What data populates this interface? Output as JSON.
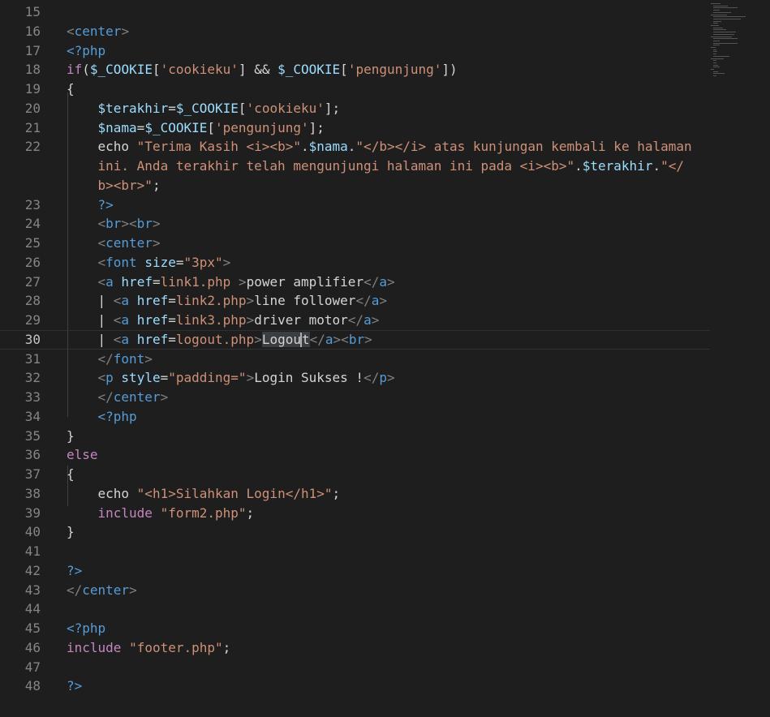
{
  "editor": {
    "active_line": 30,
    "lines": [
      {
        "n": "15",
        "indent": 0,
        "tokens": []
      },
      {
        "n": "16",
        "indent": 0,
        "tokens": [
          [
            "punc",
            "<"
          ],
          [
            "tag",
            "center"
          ],
          [
            "punc",
            ">"
          ]
        ]
      },
      {
        "n": "17",
        "indent": 0,
        "tokens": [
          [
            "tag",
            "<?php"
          ]
        ]
      },
      {
        "n": "18",
        "indent": 0,
        "tokens": [
          [
            "kw",
            "if"
          ],
          [
            "text",
            "("
          ],
          [
            "var",
            "$_COOKIE"
          ],
          [
            "text",
            "["
          ],
          [
            "str",
            "'cookieku'"
          ],
          [
            "text",
            "] && "
          ],
          [
            "var",
            "$_COOKIE"
          ],
          [
            "text",
            "["
          ],
          [
            "str",
            "'pengunjung'"
          ],
          [
            "text",
            "])"
          ]
        ]
      },
      {
        "n": "19",
        "indent": 0,
        "tokens": [
          [
            "text",
            "{"
          ]
        ]
      },
      {
        "n": "20",
        "indent": 1,
        "tokens": [
          [
            "var",
            "$terakhir"
          ],
          [
            "text",
            "="
          ],
          [
            "var",
            "$_COOKIE"
          ],
          [
            "text",
            "["
          ],
          [
            "str",
            "'cookieku'"
          ],
          [
            "text",
            "];"
          ]
        ]
      },
      {
        "n": "21",
        "indent": 1,
        "tokens": [
          [
            "var",
            "$nama"
          ],
          [
            "text",
            "="
          ],
          [
            "var",
            "$_COOKIE"
          ],
          [
            "text",
            "["
          ],
          [
            "str",
            "'pengunjung'"
          ],
          [
            "text",
            "];"
          ]
        ]
      },
      {
        "n": "22",
        "indent": 1,
        "tokens": [
          [
            "text",
            "echo "
          ],
          [
            "str",
            "\"Terima Kasih <i><b>\""
          ],
          [
            "text",
            "."
          ],
          [
            "var",
            "$nama"
          ],
          [
            "text",
            "."
          ],
          [
            "str",
            "\"</b></i> atas kunjungan kembali ke halaman"
          ]
        ]
      },
      {
        "n": "",
        "indent": 1,
        "tokens": [
          [
            "str",
            "ini. Anda terakhir telah mengunjungi halaman ini pada <i><b>\""
          ],
          [
            "text",
            "."
          ],
          [
            "var",
            "$terakhir"
          ],
          [
            "text",
            "."
          ],
          [
            "str",
            "\"</"
          ]
        ]
      },
      {
        "n": "",
        "indent": 1,
        "tokens": [
          [
            "str",
            "b><br>\""
          ],
          [
            "text",
            ";"
          ]
        ]
      },
      {
        "n": "23",
        "indent": 1,
        "tokens": [
          [
            "tag",
            "?>"
          ]
        ]
      },
      {
        "n": "24",
        "indent": 1,
        "tokens": [
          [
            "punc",
            "<"
          ],
          [
            "tag",
            "br"
          ],
          [
            "punc",
            "><"
          ],
          [
            "tag",
            "br"
          ],
          [
            "punc",
            ">"
          ]
        ]
      },
      {
        "n": "25",
        "indent": 1,
        "tokens": [
          [
            "punc",
            "<"
          ],
          [
            "tag",
            "center"
          ],
          [
            "punc",
            ">"
          ]
        ]
      },
      {
        "n": "26",
        "indent": 1,
        "tokens": [
          [
            "punc",
            "<"
          ],
          [
            "tag",
            "font"
          ],
          [
            "text",
            " "
          ],
          [
            "attr",
            "size"
          ],
          [
            "text",
            "="
          ],
          [
            "str",
            "\"3px\""
          ],
          [
            "punc",
            ">"
          ]
        ]
      },
      {
        "n": "27",
        "indent": 1,
        "tokens": [
          [
            "punc",
            "<"
          ],
          [
            "tag",
            "a"
          ],
          [
            "text",
            " "
          ],
          [
            "attr",
            "href"
          ],
          [
            "text",
            "="
          ],
          [
            "str",
            "link1.php"
          ],
          [
            "text",
            " "
          ],
          [
            "punc",
            ">"
          ],
          [
            "text",
            "power amplifier"
          ],
          [
            "punc",
            "</"
          ],
          [
            "tag",
            "a"
          ],
          [
            "punc",
            ">"
          ]
        ]
      },
      {
        "n": "28",
        "indent": 1,
        "tokens": [
          [
            "text",
            "| "
          ],
          [
            "punc",
            "<"
          ],
          [
            "tag",
            "a"
          ],
          [
            "text",
            " "
          ],
          [
            "attr",
            "href"
          ],
          [
            "text",
            "="
          ],
          [
            "str",
            "link2.php"
          ],
          [
            "punc",
            ">"
          ],
          [
            "text",
            "line follower"
          ],
          [
            "punc",
            "</"
          ],
          [
            "tag",
            "a"
          ],
          [
            "punc",
            ">"
          ]
        ]
      },
      {
        "n": "29",
        "indent": 1,
        "tokens": [
          [
            "text",
            "| "
          ],
          [
            "punc",
            "<"
          ],
          [
            "tag",
            "a"
          ],
          [
            "text",
            " "
          ],
          [
            "attr",
            "href"
          ],
          [
            "text",
            "="
          ],
          [
            "str",
            "link3.php"
          ],
          [
            "punc",
            ">"
          ],
          [
            "text",
            "driver motor"
          ],
          [
            "punc",
            "</"
          ],
          [
            "tag",
            "a"
          ],
          [
            "punc",
            ">"
          ]
        ]
      },
      {
        "n": "30",
        "indent": 1,
        "tokens": [
          [
            "text",
            "| "
          ],
          [
            "punc",
            "<"
          ],
          [
            "tag",
            "a"
          ],
          [
            "text",
            " "
          ],
          [
            "attr",
            "href"
          ],
          [
            "text",
            "="
          ],
          [
            "str",
            "logout.php"
          ],
          [
            "punc",
            ">"
          ],
          [
            "hl",
            "Logou"
          ],
          [
            "cursor",
            ""
          ],
          [
            "hl",
            "t"
          ],
          [
            "punc",
            "</"
          ],
          [
            "tag",
            "a"
          ],
          [
            "punc",
            "><"
          ],
          [
            "tag",
            "br"
          ],
          [
            "punc",
            ">"
          ]
        ]
      },
      {
        "n": "31",
        "indent": 1,
        "tokens": [
          [
            "punc",
            "</"
          ],
          [
            "tag",
            "font"
          ],
          [
            "punc",
            ">"
          ]
        ]
      },
      {
        "n": "32",
        "indent": 1,
        "tokens": [
          [
            "punc",
            "<"
          ],
          [
            "tag",
            "p"
          ],
          [
            "text",
            " "
          ],
          [
            "attr",
            "style"
          ],
          [
            "text",
            "="
          ],
          [
            "str",
            "\"padding=\""
          ],
          [
            "punc",
            ">"
          ],
          [
            "text",
            "Login Sukses !"
          ],
          [
            "punc",
            "</"
          ],
          [
            "tag",
            "p"
          ],
          [
            "punc",
            ">"
          ]
        ]
      },
      {
        "n": "33",
        "indent": 1,
        "tokens": [
          [
            "punc",
            "</"
          ],
          [
            "tag",
            "center"
          ],
          [
            "punc",
            ">"
          ]
        ]
      },
      {
        "n": "34",
        "indent": 1,
        "tokens": [
          [
            "tag",
            "<?php"
          ]
        ]
      },
      {
        "n": "35",
        "indent": 0,
        "tokens": [
          [
            "text",
            "}"
          ]
        ]
      },
      {
        "n": "36",
        "indent": 0,
        "tokens": [
          [
            "kw",
            "else"
          ]
        ]
      },
      {
        "n": "37",
        "indent": 0,
        "tokens": [
          [
            "text",
            "{"
          ]
        ]
      },
      {
        "n": "38",
        "indent": 1,
        "tokens": [
          [
            "text",
            "echo "
          ],
          [
            "str",
            "\"<h1>Silahkan Login</h1>\""
          ],
          [
            "text",
            ";"
          ]
        ]
      },
      {
        "n": "39",
        "indent": 1,
        "tokens": [
          [
            "kw",
            "include"
          ],
          [
            "text",
            " "
          ],
          [
            "str",
            "\"form2.php\""
          ],
          [
            "text",
            ";"
          ]
        ]
      },
      {
        "n": "40",
        "indent": 0,
        "tokens": [
          [
            "text",
            "}"
          ]
        ]
      },
      {
        "n": "41",
        "indent": 0,
        "tokens": []
      },
      {
        "n": "42",
        "indent": 0,
        "tokens": [
          [
            "tag",
            "?>"
          ]
        ]
      },
      {
        "n": "43",
        "indent": 0,
        "tokens": [
          [
            "punc",
            "</"
          ],
          [
            "tag",
            "center"
          ],
          [
            "punc",
            ">"
          ]
        ]
      },
      {
        "n": "44",
        "indent": 0,
        "tokens": []
      },
      {
        "n": "45",
        "indent": 0,
        "tokens": [
          [
            "tag",
            "<?php"
          ]
        ]
      },
      {
        "n": "46",
        "indent": 0,
        "tokens": [
          [
            "kw",
            "include"
          ],
          [
            "text",
            " "
          ],
          [
            "str",
            "\"footer.php\""
          ],
          [
            "text",
            ";"
          ]
        ]
      },
      {
        "n": "47",
        "indent": 0,
        "tokens": []
      },
      {
        "n": "48",
        "indent": 0,
        "tokens": [
          [
            "tag",
            "?>"
          ]
        ]
      }
    ]
  }
}
